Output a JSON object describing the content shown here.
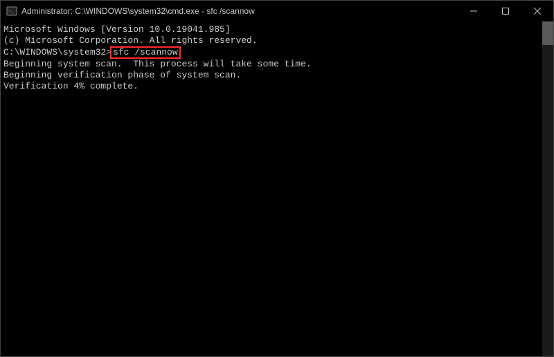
{
  "window": {
    "title": "Administrator: C:\\WINDOWS\\system32\\cmd.exe - sfc  /scannow"
  },
  "terminal": {
    "line1": "Microsoft Windows [Version 10.0.19041.985]",
    "line2": "(c) Microsoft Corporation. All rights reserved.",
    "blank1": "",
    "prompt": "C:\\WINDOWS\\system32>",
    "command": "sfc /scannow",
    "blank2": "",
    "scan1": "Beginning system scan.  This process will take some time.",
    "blank3": "",
    "scan2": "Beginning verification phase of system scan.",
    "scan3": "Verification 4% complete."
  }
}
